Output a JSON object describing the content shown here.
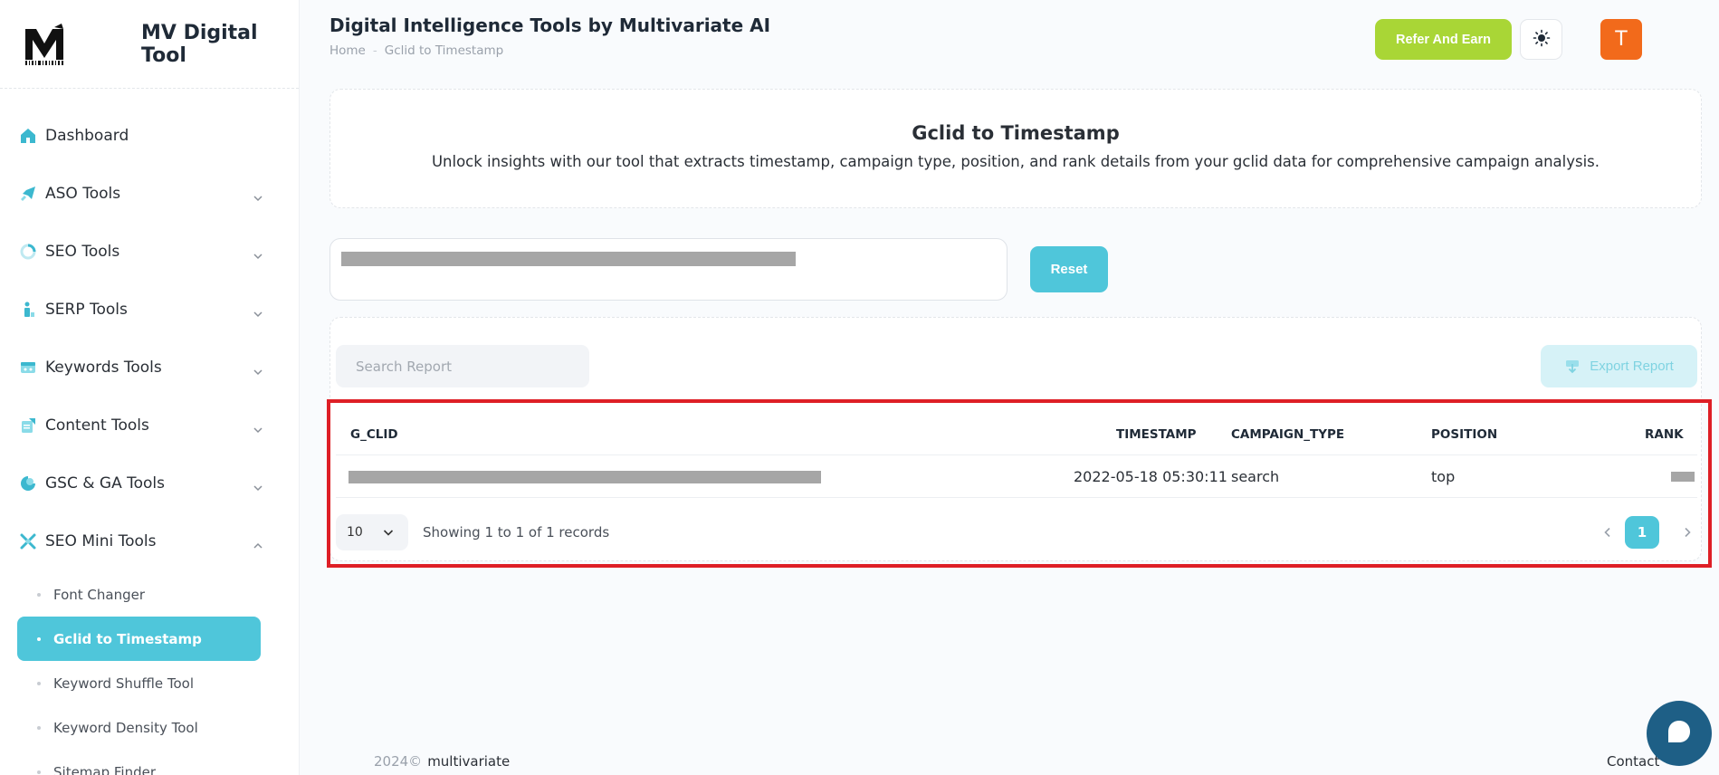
{
  "brand": {
    "name": "MV Digital Tool"
  },
  "header": {
    "title": "Digital Intelligence Tools by Multivariate AI",
    "breadcrumb": [
      "Home",
      "Gclid to Timestamp"
    ],
    "refer_label": "Refer And Earn",
    "avatar_initial": "T"
  },
  "sidebar": {
    "items": [
      {
        "label": "Dashboard",
        "icon": "home-icon"
      },
      {
        "label": "ASO Tools",
        "icon": "rocket-icon"
      },
      {
        "label": "SEO Tools",
        "icon": "spinner-icon"
      },
      {
        "label": "SERP Tools",
        "icon": "bar-chart-icon"
      },
      {
        "label": "Keywords Tools",
        "icon": "keyboard-icon"
      },
      {
        "label": "Content Tools",
        "icon": "content-icon"
      },
      {
        "label": "GSC & GA Tools",
        "icon": "analytics-icon"
      },
      {
        "label": "SEO Mini Tools",
        "icon": "tools-icon"
      }
    ],
    "sub_items": [
      {
        "label": "Font Changer",
        "active": false
      },
      {
        "label": "Gclid to Timestamp",
        "active": true
      },
      {
        "label": "Keyword Shuffle Tool",
        "active": false
      },
      {
        "label": "Keyword Density Tool",
        "active": false
      },
      {
        "label": "Sitemap Finder",
        "active": false
      }
    ]
  },
  "info": {
    "title": "Gclid to Timestamp",
    "description": "Unlock insights with our tool that extracts timestamp, campaign type, position, and rank details from your gclid data for comprehensive campaign analysis."
  },
  "input": {
    "reset_label": "Reset"
  },
  "report": {
    "search_placeholder": "Search Report",
    "export_label": "Export Report",
    "columns": [
      "G_CLID",
      "TIMESTAMP",
      "CAMPAIGN_TYPE",
      "POSITION",
      "RANK"
    ],
    "rows": [
      {
        "timestamp": "2022-05-18 05:30:11",
        "campaign_type": "search",
        "position": "top"
      }
    ],
    "page_size": "10",
    "showing": "Showing 1 to 1 of 1 records",
    "current_page": "1"
  },
  "footer": {
    "copyright": "2024©",
    "brand": "multivariate",
    "contact": "Contact"
  },
  "colors": {
    "accent": "#4fc6da",
    "refer": "#a9d636",
    "avatar": "#f26a1b",
    "highlight": "#de1f26",
    "chat": "#1e5f86"
  }
}
